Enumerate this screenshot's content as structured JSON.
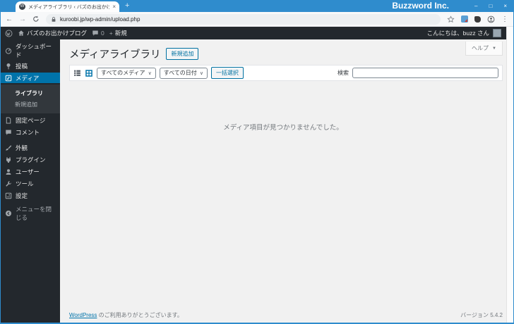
{
  "colors": {
    "titlebar": "#2f8ccd",
    "adminbar": "#23282d",
    "accent": "#0073aa",
    "content_bg": "#f1f1f1"
  },
  "browser": {
    "tab_title": "メディアライブラリ ‹ バズのお出かけブ",
    "window_title": "Buzzword Inc.",
    "url": "kuroobi.jp/wp-admin/upload.php",
    "glyphs": {
      "favicon": "W",
      "tab_close": "×",
      "new_tab": "+",
      "back": "←",
      "forward": "→",
      "minimize": "–",
      "maximize": "□",
      "close": "×",
      "kebab": "⋮"
    }
  },
  "adminbar": {
    "site_name": "バズのお出かけブログ",
    "comments_count": "0",
    "new_glyph": "+",
    "new_label": "新規",
    "greeting": "こんにちは、buzz さん"
  },
  "sidebar": {
    "items": [
      {
        "label": "ダッシュボード"
      },
      {
        "label": "投稿"
      },
      {
        "label": "メディア"
      },
      {
        "label": "固定ページ"
      },
      {
        "label": "コメント"
      },
      {
        "label": "外観"
      },
      {
        "label": "プラグイン"
      },
      {
        "label": "ユーザー"
      },
      {
        "label": "ツール"
      },
      {
        "label": "設定"
      },
      {
        "label": "メニューを閉じる"
      }
    ],
    "media_submenu": [
      {
        "label": "ライブラリ"
      },
      {
        "label": "新規追加"
      }
    ]
  },
  "main": {
    "page_title": "メディアライブラリ",
    "add_new_label": "新規追加",
    "help_label": "ヘルプ",
    "help_caret": "▼",
    "media_filter": "すべてのメディア",
    "date_filter": "すべての日付",
    "filter_caret": "∨",
    "bulk_select_label": "一括選択",
    "search_label": "検索",
    "search_value": "",
    "empty_message": "メディア項目が見つかりませんでした。"
  },
  "footer": {
    "link": "WordPress",
    "text": " のご利用ありがとうございます。",
    "version": "バージョン 5.4.2"
  }
}
